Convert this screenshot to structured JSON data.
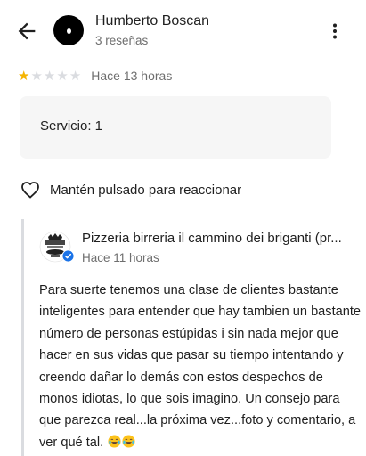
{
  "header": {
    "user_name": "Humberto Boscan",
    "review_count": "3 reseñas"
  },
  "review": {
    "rating": 1,
    "max_rating": 5,
    "time": "Hace 13 horas",
    "detail": "Servicio: 1",
    "react_label": "Mantén pulsado para reaccionar"
  },
  "owner_reply": {
    "name": "Pizzeria birreria il cammino dei briganti (pr...",
    "time": "Hace 11 horas",
    "text": "Para suerte tenemos una clase de clientes bastante inteligentes para entender que hay tambien un bastante número de personas estúpidas i sin nada mejor que hacer en sus vidas que pasar su tiempo intentando y creendo dañar lo demás con estos despechos de monos idiotas, lo que sois imagino. Un consejo para que parezca real...la próxima vez...foto y comentario, a ver qué tal.",
    "trailing_emojis": [
      "face-with-tears-of-joy-emoji",
      "face-with-tears-of-joy-emoji"
    ]
  },
  "icons": {
    "back": "arrow-left-icon",
    "more": "more-vert-icon",
    "react": "heart-outline-icon",
    "verified": "verified-badge-icon"
  },
  "colors": {
    "star_filled": "#f5b400",
    "star_empty": "#dadce0",
    "verified": "#1a73e8",
    "detail_bg": "#f6f6f6"
  }
}
